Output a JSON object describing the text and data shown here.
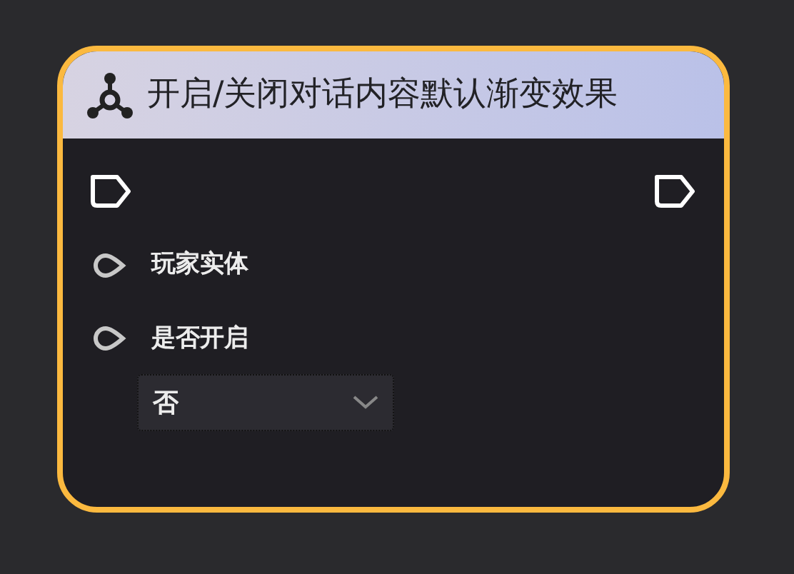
{
  "node": {
    "title": "开启/关闭对话内容默认渐变效果",
    "inputs": [
      {
        "label": "玩家实体"
      },
      {
        "label": "是否开启",
        "dropdown": {
          "value": "否"
        }
      }
    ]
  }
}
